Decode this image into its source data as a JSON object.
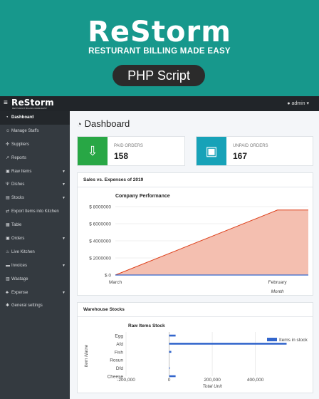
{
  "hero": {
    "brand": "ReStorm",
    "tagline": "RESTURANT BILLING MADE EASY",
    "pill": "PHP Script"
  },
  "navbar": {
    "logo": "ReStorm",
    "logo_sub": "RESTURANT BILLING MADE EASY",
    "user": "admin",
    "menu_icon": "hamburger-icon",
    "user_icon": "user-icon"
  },
  "sidebar": {
    "items": [
      {
        "label": "Dashboard",
        "icon": "tachometer-icon",
        "glyph": "◔",
        "active": true,
        "caret": ""
      },
      {
        "label": "Manage Staffs",
        "icon": "users-icon",
        "glyph": "☺",
        "active": false,
        "caret": ""
      },
      {
        "label": "Suppliers",
        "icon": "handshake-icon",
        "glyph": "✣",
        "active": false,
        "caret": ""
      },
      {
        "label": "Reports",
        "icon": "chart-icon",
        "glyph": "↗",
        "active": false,
        "caret": ""
      },
      {
        "label": "Raw Items",
        "icon": "cart-icon",
        "glyph": "▣",
        "active": false,
        "caret": "▼"
      },
      {
        "label": "Dishes",
        "icon": "utensils-icon",
        "glyph": "Ψ",
        "active": false,
        "caret": "▼"
      },
      {
        "label": "Stocks",
        "icon": "bag-icon",
        "glyph": "▤",
        "active": false,
        "caret": "▼"
      },
      {
        "label": "Export Items into Kitchen",
        "icon": "exchange-icon",
        "glyph": "⇄",
        "active": false,
        "caret": ""
      },
      {
        "label": "Table",
        "icon": "table-icon",
        "glyph": "▦",
        "active": false,
        "caret": ""
      },
      {
        "label": "Orders",
        "icon": "cart-icon",
        "glyph": "▣",
        "active": false,
        "caret": "▼"
      },
      {
        "label": "Live Kitchen",
        "icon": "fire-icon",
        "glyph": "♨",
        "active": false,
        "caret": ""
      },
      {
        "label": "Invoices",
        "icon": "invoice-icon",
        "glyph": "▬",
        "active": false,
        "caret": "▼"
      },
      {
        "label": "Wastage",
        "icon": "trash-icon",
        "glyph": "▥",
        "active": false,
        "caret": ""
      },
      {
        "label": "Expense",
        "icon": "money-icon",
        "glyph": "♣",
        "active": false,
        "caret": "▼"
      },
      {
        "label": "General settings",
        "icon": "gears-icon",
        "glyph": "✱",
        "active": false,
        "caret": ""
      }
    ]
  },
  "main": {
    "title": "Dashboard",
    "paid": {
      "label": "PAID ORDERS",
      "value": "158",
      "color": "#28a745"
    },
    "unpaid": {
      "label": "UNPAID ORDERS",
      "value": "167",
      "color": "#17a2b8"
    },
    "sales_card_title": "Sales vs. Expenses of 2019",
    "stock_card_title": "Warehouse Stocks"
  },
  "chart_data": [
    {
      "type": "area",
      "title": "Company Performance",
      "xlabel": "Month",
      "ylabel": "",
      "categories": [
        "March",
        "February"
      ],
      "ylim": [
        0,
        8000000
      ],
      "yticks": [
        0,
        2000000,
        4000000,
        6000000,
        8000000
      ],
      "ytick_labels": [
        "$ 0",
        "$ 2000000",
        "$ 4000000",
        "$ 6000000",
        "$ 8000000"
      ],
      "series": [
        {
          "color": "#dc3912",
          "fill": "#f4bfb0",
          "points": [
            [
              0,
              0
            ],
            [
              0.84,
              7600000
            ],
            [
              1,
              7600000
            ]
          ]
        },
        {
          "color": "#3366cc",
          "points": [
            [
              0,
              0
            ],
            [
              1,
              0
            ]
          ]
        }
      ],
      "legend": "none"
    },
    {
      "type": "bar",
      "orientation": "horizontal",
      "title": "Raw Items Stock",
      "xlabel": "Total Unit",
      "ylabel": "Item Name",
      "categories": [
        "Egg",
        "Afd",
        "Fish",
        "Rosun",
        "Dfd",
        "Cheese"
      ],
      "xlim": [
        -200000,
        550000
      ],
      "xticks": [
        -200000,
        0,
        200000,
        400000
      ],
      "xtick_labels": [
        "-200,000",
        "0",
        "200,000",
        "400,000"
      ],
      "series": [
        {
          "name": "Items in stock",
          "color": "#3366cc",
          "values": [
            30000,
            545000,
            10000,
            0,
            2000,
            30000
          ]
        }
      ],
      "legend": "right"
    }
  ]
}
